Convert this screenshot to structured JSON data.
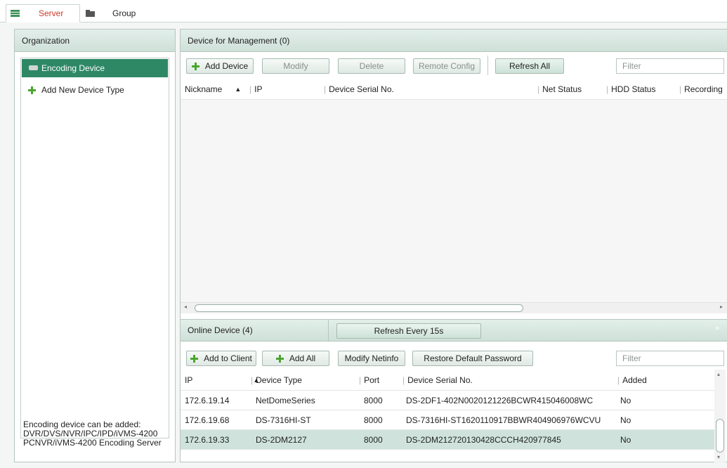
{
  "top_tabs": [
    {
      "label": "Server"
    },
    {
      "label": "Group"
    }
  ],
  "organization": {
    "header": "Organization",
    "items": [
      {
        "label": "Encoding Device"
      },
      {
        "label": "Add New Device Type"
      }
    ],
    "note_lines": [
      "Encoding device can be added:",
      "DVR/DVS/NVR/IPC/IPD/iVMS-4200",
      "PCNVR/iVMS-4200 Encoding Server"
    ]
  },
  "management": {
    "header": "Device for Management (0)",
    "buttons": {
      "add": "Add Device",
      "modify": "Modify",
      "delete": "Delete",
      "remote": "Remote Config",
      "refresh": "Refresh All"
    },
    "filter_placeholder": "Filter",
    "columns": [
      "Nickname",
      "IP",
      "Device Serial No.",
      "Net Status",
      "HDD Status",
      "Recording"
    ]
  },
  "online": {
    "header": "Online Device (4)",
    "refresh_button": "Refresh Every 15s",
    "buttons": {
      "add_client": "Add to Client",
      "add_all": "Add All",
      "modify_netinfo": "Modify Netinfo",
      "restore": "Restore Default Password"
    },
    "filter_placeholder": "Filter",
    "columns": [
      "IP",
      "Device Type",
      "Port",
      "Device Serial No.",
      "Added"
    ],
    "rows": [
      {
        "ip": "172.6.19.14",
        "type": "NetDomeSeries",
        "port": "8000",
        "serial": "DS-2DF1-402N0020121226BCWR415046008WC",
        "added": "No"
      },
      {
        "ip": "172.6.19.68",
        "type": "DS-7316HI-ST",
        "port": "8000",
        "serial": "DS-7316HI-ST1620110917BBWR404906976WCVU",
        "added": "No"
      },
      {
        "ip": "172.6.19.33",
        "type": "DS-2DM2127",
        "port": "8000",
        "serial": "DS-2DM212720130428CCCH420977845",
        "added": "No"
      }
    ]
  },
  "colors": {
    "accent": "#2e8866",
    "header_bg": "#d8e8e1",
    "selected_row": "#cfe3dc",
    "active_tab": "#cc3a2a"
  }
}
